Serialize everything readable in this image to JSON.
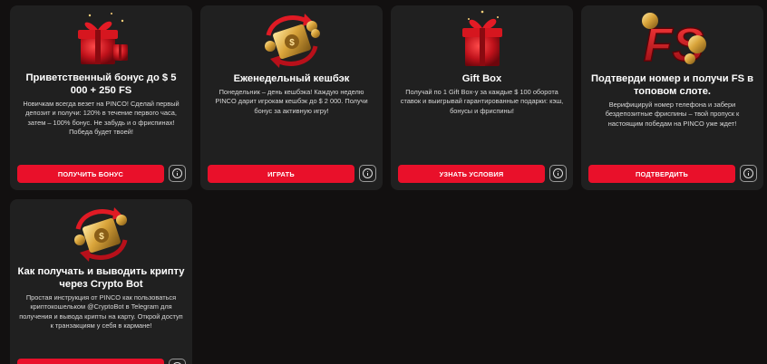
{
  "colors": {
    "background": "#121010",
    "card": "#202020",
    "accent": "#e9102a"
  },
  "cards": [
    {
      "title": "Приветственный бонус до $ 5 000 + 250 FS",
      "description": "Новичкам всегда везет на PINCO! Сделай первый депозит и получи: 120% в течение первого часа, затем – 100% бонус. Не забудь и о фриспинах! Победа будет твоей!",
      "button": "ПОЛУЧИТЬ БОНУС",
      "image": "gift-icon"
    },
    {
      "title": "Еженедельный кешбэк",
      "description": "Понедельник – день кешбэка! Каждую неделю PINCO дарит игрокам кешбэк до $ 2 000. Получи бонус за активную игру!",
      "button": "ИГРАТЬ",
      "image": "cashback-icon"
    },
    {
      "title": "Gift Box",
      "description": "Получай по 1 Gift Box-у за каждые $ 100 оборота ставок и выигрывай гарантированные подарки: кэш, бонусы и фриспины!",
      "button": "УЗНАТЬ УСЛОВИЯ",
      "image": "gift-box-icon"
    },
    {
      "title": "Подтверди номер и получи FS в топовом слоте.",
      "description": "Верифицируй номер телефона и забери бездепозитные фриспины – твой пропуск к настоящим победам на PINCO уже ждет!",
      "button": "ПОДТВЕРДИТЬ",
      "image": "free-spins-icon",
      "badge": "FS"
    },
    {
      "title": "Как получать и выводить крипту через Crypto Bot",
      "description": "Простая инструкция от PINCO как пользоваться криптокошельком @CryptoBot в Telegram для получения и вывода крипты на карту. Открой доступ к транзакциям у себя в кармане!",
      "button": "",
      "image": "crypto-wallet-icon"
    }
  ]
}
